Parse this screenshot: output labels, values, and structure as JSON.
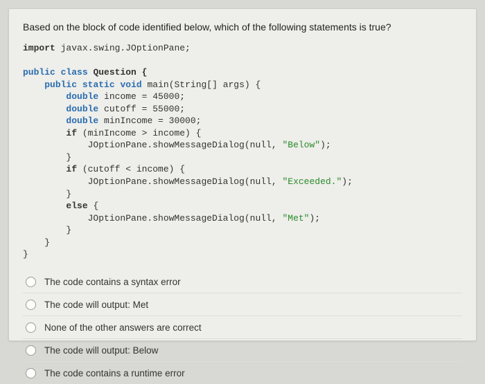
{
  "question": "Based on the block of code identified below, which of the following statements is true?",
  "code": {
    "l01a": "import",
    "l01b": " javax.swing.JOptionPane;",
    "l02a": "public",
    "l02b": "class",
    "l02c": " Question {",
    "l03a": "public",
    "l03b": "static",
    "l03c": "void",
    "l03d": " main(String[] args) {",
    "l04a": "double",
    "l04b": " income = 45000;",
    "l05a": "double",
    "l05b": " cutoff = 55000;",
    "l06a": "double",
    "l06b": " minIncome = 30000;",
    "l07a": "if",
    "l07b": " (minIncome > income) {",
    "l08a": "            JOptionPane.showMessageDialog(null, ",
    "l08b": "\"Below\"",
    "l08c": ");",
    "l09": "        }",
    "l10a": "if",
    "l10b": " (cutoff < income) {",
    "l11a": "            JOptionPane.showMessageDialog(null, ",
    "l11b": "\"Exceeded.\"",
    "l11c": ");",
    "l12": "        }",
    "l13a": "else",
    "l13b": " {",
    "l14a": "            JOptionPane.showMessageDialog(null, ",
    "l14b": "\"Met\"",
    "l14c": ");",
    "l15": "        }",
    "l16": "    }",
    "l17": "}"
  },
  "options": [
    "The code contains a syntax error",
    "The code will output: Met",
    "None of the other answers are correct",
    "The code will output: Below",
    "The code contains a runtime error"
  ]
}
